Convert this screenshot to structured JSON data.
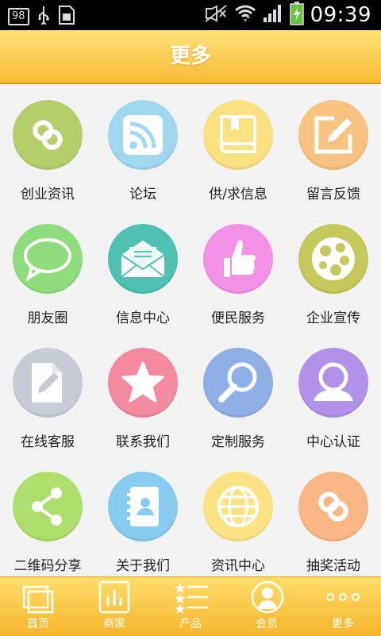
{
  "status_bar": {
    "badge": "98",
    "time": "09:39"
  },
  "title_bar": {
    "title": "更多"
  },
  "colors": {
    "accent": "#f7ba33",
    "circle_green": "#b4cf6a",
    "circle_blue": "#9fd8ef",
    "circle_yellow": "#fbe07f",
    "circle_orange": "#f8c280",
    "circle_lightgreen": "#8fdc7c",
    "circle_teal": "#4fc2b4",
    "circle_pink": "#f391e7",
    "circle_olive": "#c5c85a",
    "circle_gray": "#c6cdd6",
    "circle_red": "#f48a9f",
    "circle_bluepurple": "#8fb0e6",
    "circle_purple": "#b291e9",
    "circle_lime": "#aede6c",
    "circle_skyblue": "#87ccf0",
    "circle_cream": "#fbe384",
    "circle_peach": "#f8b784"
  },
  "grid": [
    {
      "label": "创业资讯",
      "icon": "link-icon"
    },
    {
      "label": "论坛",
      "icon": "rss-icon"
    },
    {
      "label": "供/求信息",
      "icon": "book-icon"
    },
    {
      "label": "留言反馈",
      "icon": "edit-icon"
    },
    {
      "label": "朋友圈",
      "icon": "chat-bubble-icon"
    },
    {
      "label": "信息中心",
      "icon": "envelope-icon"
    },
    {
      "label": "便民服务",
      "icon": "thumbs-up-icon"
    },
    {
      "label": "企业宣传",
      "icon": "film-reel-icon"
    },
    {
      "label": "在线客服",
      "icon": "document-pen-icon"
    },
    {
      "label": "联系我们",
      "icon": "star-icon"
    },
    {
      "label": "定制服务",
      "icon": "magnifier-icon"
    },
    {
      "label": "中心认证",
      "icon": "user-icon"
    },
    {
      "label": "二维码分享",
      "icon": "share-icon"
    },
    {
      "label": "关于我们",
      "icon": "contacts-book-icon"
    },
    {
      "label": "资讯中心",
      "icon": "globe-icon"
    },
    {
      "label": "抽奖活动",
      "icon": "link-icon"
    }
  ],
  "bottom_nav": [
    {
      "label": "首页",
      "icon": "pages-icon"
    },
    {
      "label": "商家",
      "icon": "bar-chart-icon"
    },
    {
      "label": "产品",
      "icon": "star-list-icon"
    },
    {
      "label": "会员",
      "icon": "member-icon"
    },
    {
      "label": "更多",
      "icon": "dots-icon"
    }
  ]
}
